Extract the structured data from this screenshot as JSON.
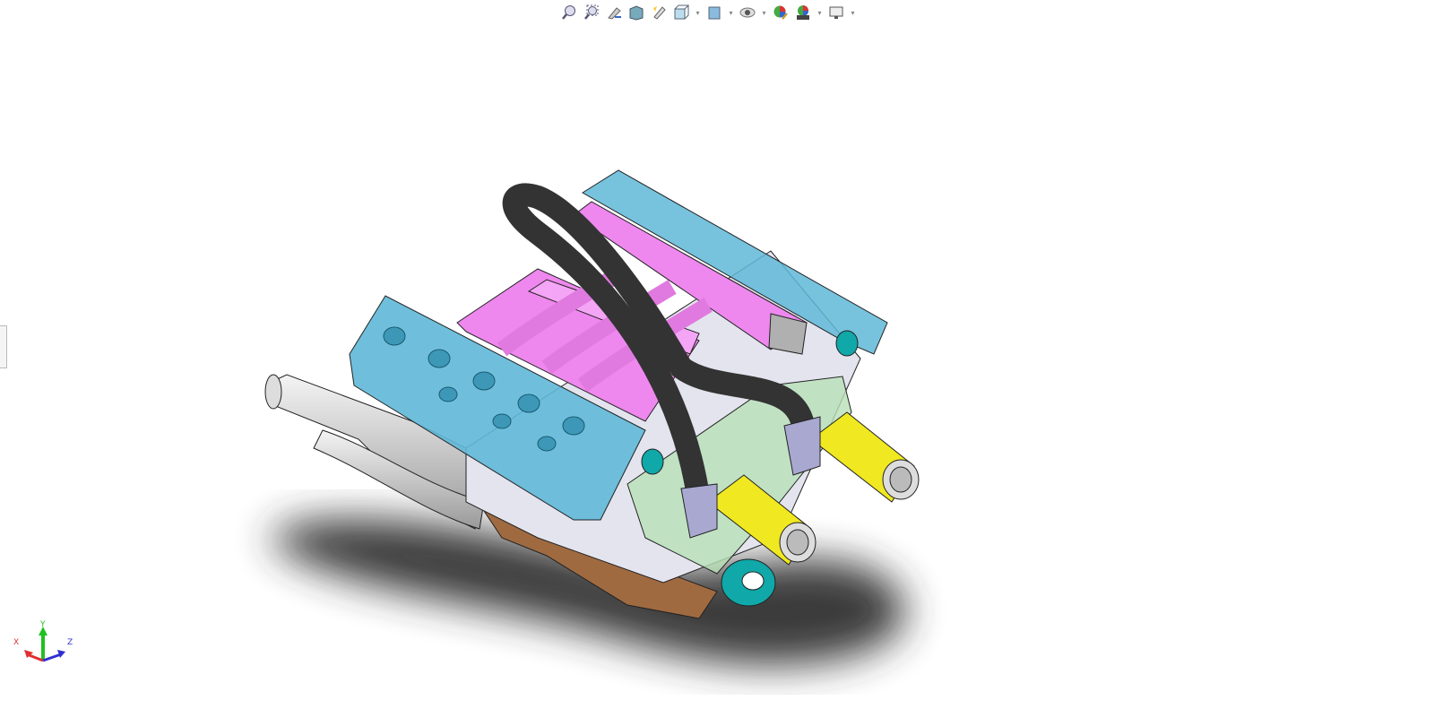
{
  "toolbar": {
    "items": [
      {
        "name": "zoom-to-fit-icon",
        "dropdown": false
      },
      {
        "name": "zoom-to-area-icon",
        "dropdown": false
      },
      {
        "name": "previous-view-icon",
        "dropdown": false
      },
      {
        "name": "section-view-icon",
        "dropdown": false
      },
      {
        "name": "dynamic-annotation-views-icon",
        "dropdown": false
      },
      {
        "name": "view-orientation-icon",
        "dropdown": true
      },
      {
        "name": "display-style-icon",
        "dropdown": true
      },
      {
        "name": "hide-show-items-icon",
        "dropdown": true
      },
      {
        "name": "edit-appearance-icon",
        "dropdown": false
      },
      {
        "name": "apply-scene-icon",
        "dropdown": true
      },
      {
        "name": "view-settings-icon",
        "dropdown": true
      }
    ]
  },
  "triad": {
    "x_label": "X",
    "y_label": "Y",
    "z_label": "Z",
    "colors": {
      "x": "#e03030",
      "y": "#20c020",
      "z": "#3030d0"
    }
  },
  "model_colors": {
    "head": "#5fb8d8",
    "manifold": "#ee88ee",
    "hose": "#333333",
    "filter": "#f0e820",
    "pan": "#a06a40",
    "pulley": "#10a8a8"
  }
}
